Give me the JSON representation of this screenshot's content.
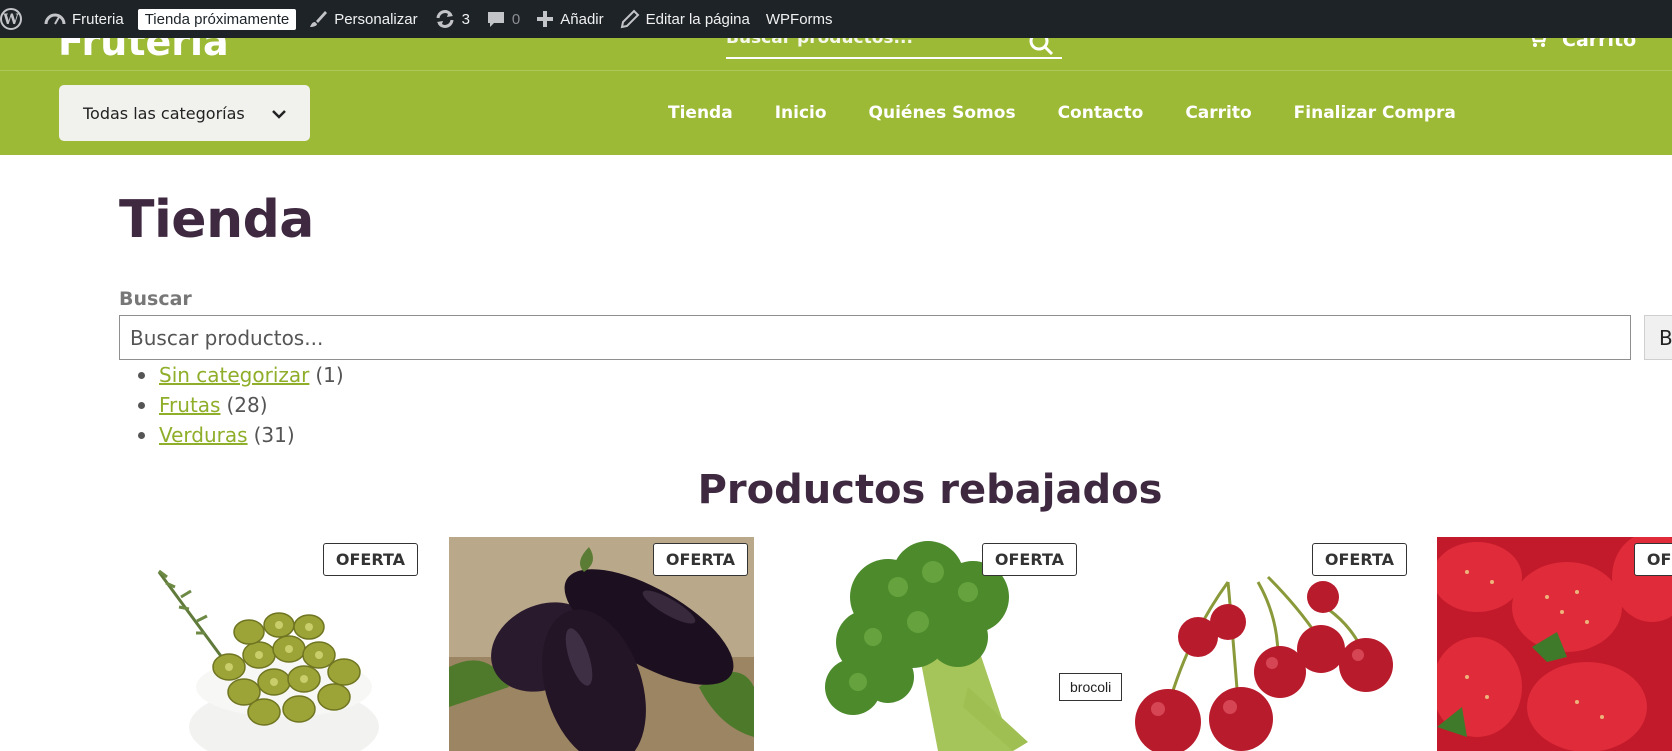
{
  "adminbar": {
    "site_name": "Fruteria",
    "coming_soon_badge": "Tienda próximamente",
    "customize": "Personalizar",
    "updates_count": "3",
    "comments_count": "0",
    "add_new": "Añadir",
    "edit_page": "Editar la página",
    "wpforms": "WPForms"
  },
  "header": {
    "logo": "Fruteria",
    "search_placeholder": "Buscar productos...",
    "cart_label": "Carrito",
    "categories_button": "Todas las categorías",
    "nav": [
      "Tienda",
      "Inicio",
      "Quiénes Somos",
      "Contacto",
      "Carrito",
      "Finalizar Compra"
    ],
    "brand_color": "#9cba35"
  },
  "main": {
    "title": "Tienda",
    "search_label": "Buscar",
    "search_placeholder": "Buscar productos...",
    "search_button": "Bu",
    "categories": [
      {
        "name": "Sin categorizar",
        "count": "(1)"
      },
      {
        "name": "Frutas",
        "count": "(28)"
      },
      {
        "name": "Verduras",
        "count": "(31)"
      }
    ],
    "sale_section_title": "Productos rebajados",
    "sale_badge": "OFERTA",
    "tooltip": "brocoli",
    "products": [
      {
        "image": "olives"
      },
      {
        "image": "eggplant"
      },
      {
        "image": "broccoli"
      },
      {
        "image": "cherries"
      },
      {
        "image": "strawberries"
      }
    ]
  }
}
